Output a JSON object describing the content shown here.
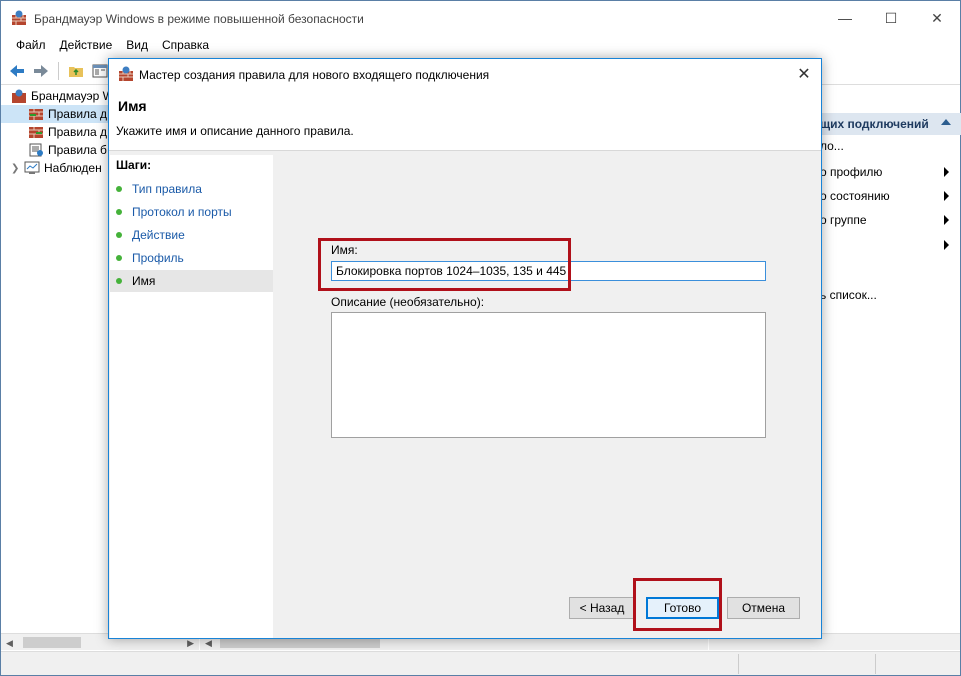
{
  "main": {
    "title": "Брандмауэр Windows в режиме повышенной безопасности",
    "controls": {
      "minimize": "—",
      "maximize": "☐",
      "close": "✕"
    },
    "menu": [
      "Файл",
      "Действие",
      "Вид",
      "Справка"
    ]
  },
  "tree": {
    "items": [
      {
        "label": "Брандмауэр W"
      },
      {
        "label": "Правила д"
      },
      {
        "label": "Правила д"
      },
      {
        "label": "Правила б"
      },
      {
        "label": "Наблюден"
      }
    ]
  },
  "actions": {
    "header": "щих подключений",
    "rows": [
      {
        "label": "ло..."
      },
      {
        "label": "о профилю"
      },
      {
        "label": "о состоянию"
      },
      {
        "label": "о группе"
      },
      {
        "label": ""
      },
      {
        "label": "ь список..."
      }
    ]
  },
  "dialog": {
    "title": "Мастер создания правила для нового входящего подключения",
    "close": "✕",
    "header_title": "Имя",
    "header_subtitle": "Укажите имя и описание данного правила.",
    "steps_title": "Шаги:",
    "steps": [
      {
        "label": "Тип правила"
      },
      {
        "label": "Протокол и порты"
      },
      {
        "label": "Действие"
      },
      {
        "label": "Профиль"
      },
      {
        "label": "Имя"
      }
    ],
    "name_label": "Имя:",
    "name_value": "Блокировка портов 1024–1035, 135 и 445",
    "description_label": "Описание (необязательно):",
    "description_value": "",
    "buttons": {
      "back": "< Назад",
      "finish": "Готово",
      "cancel": "Отмена"
    }
  },
  "colors": {
    "accent": "#0078d7",
    "highlight": "#b0101a",
    "link": "#1a5aa8",
    "step_dot": "#45b23a"
  }
}
